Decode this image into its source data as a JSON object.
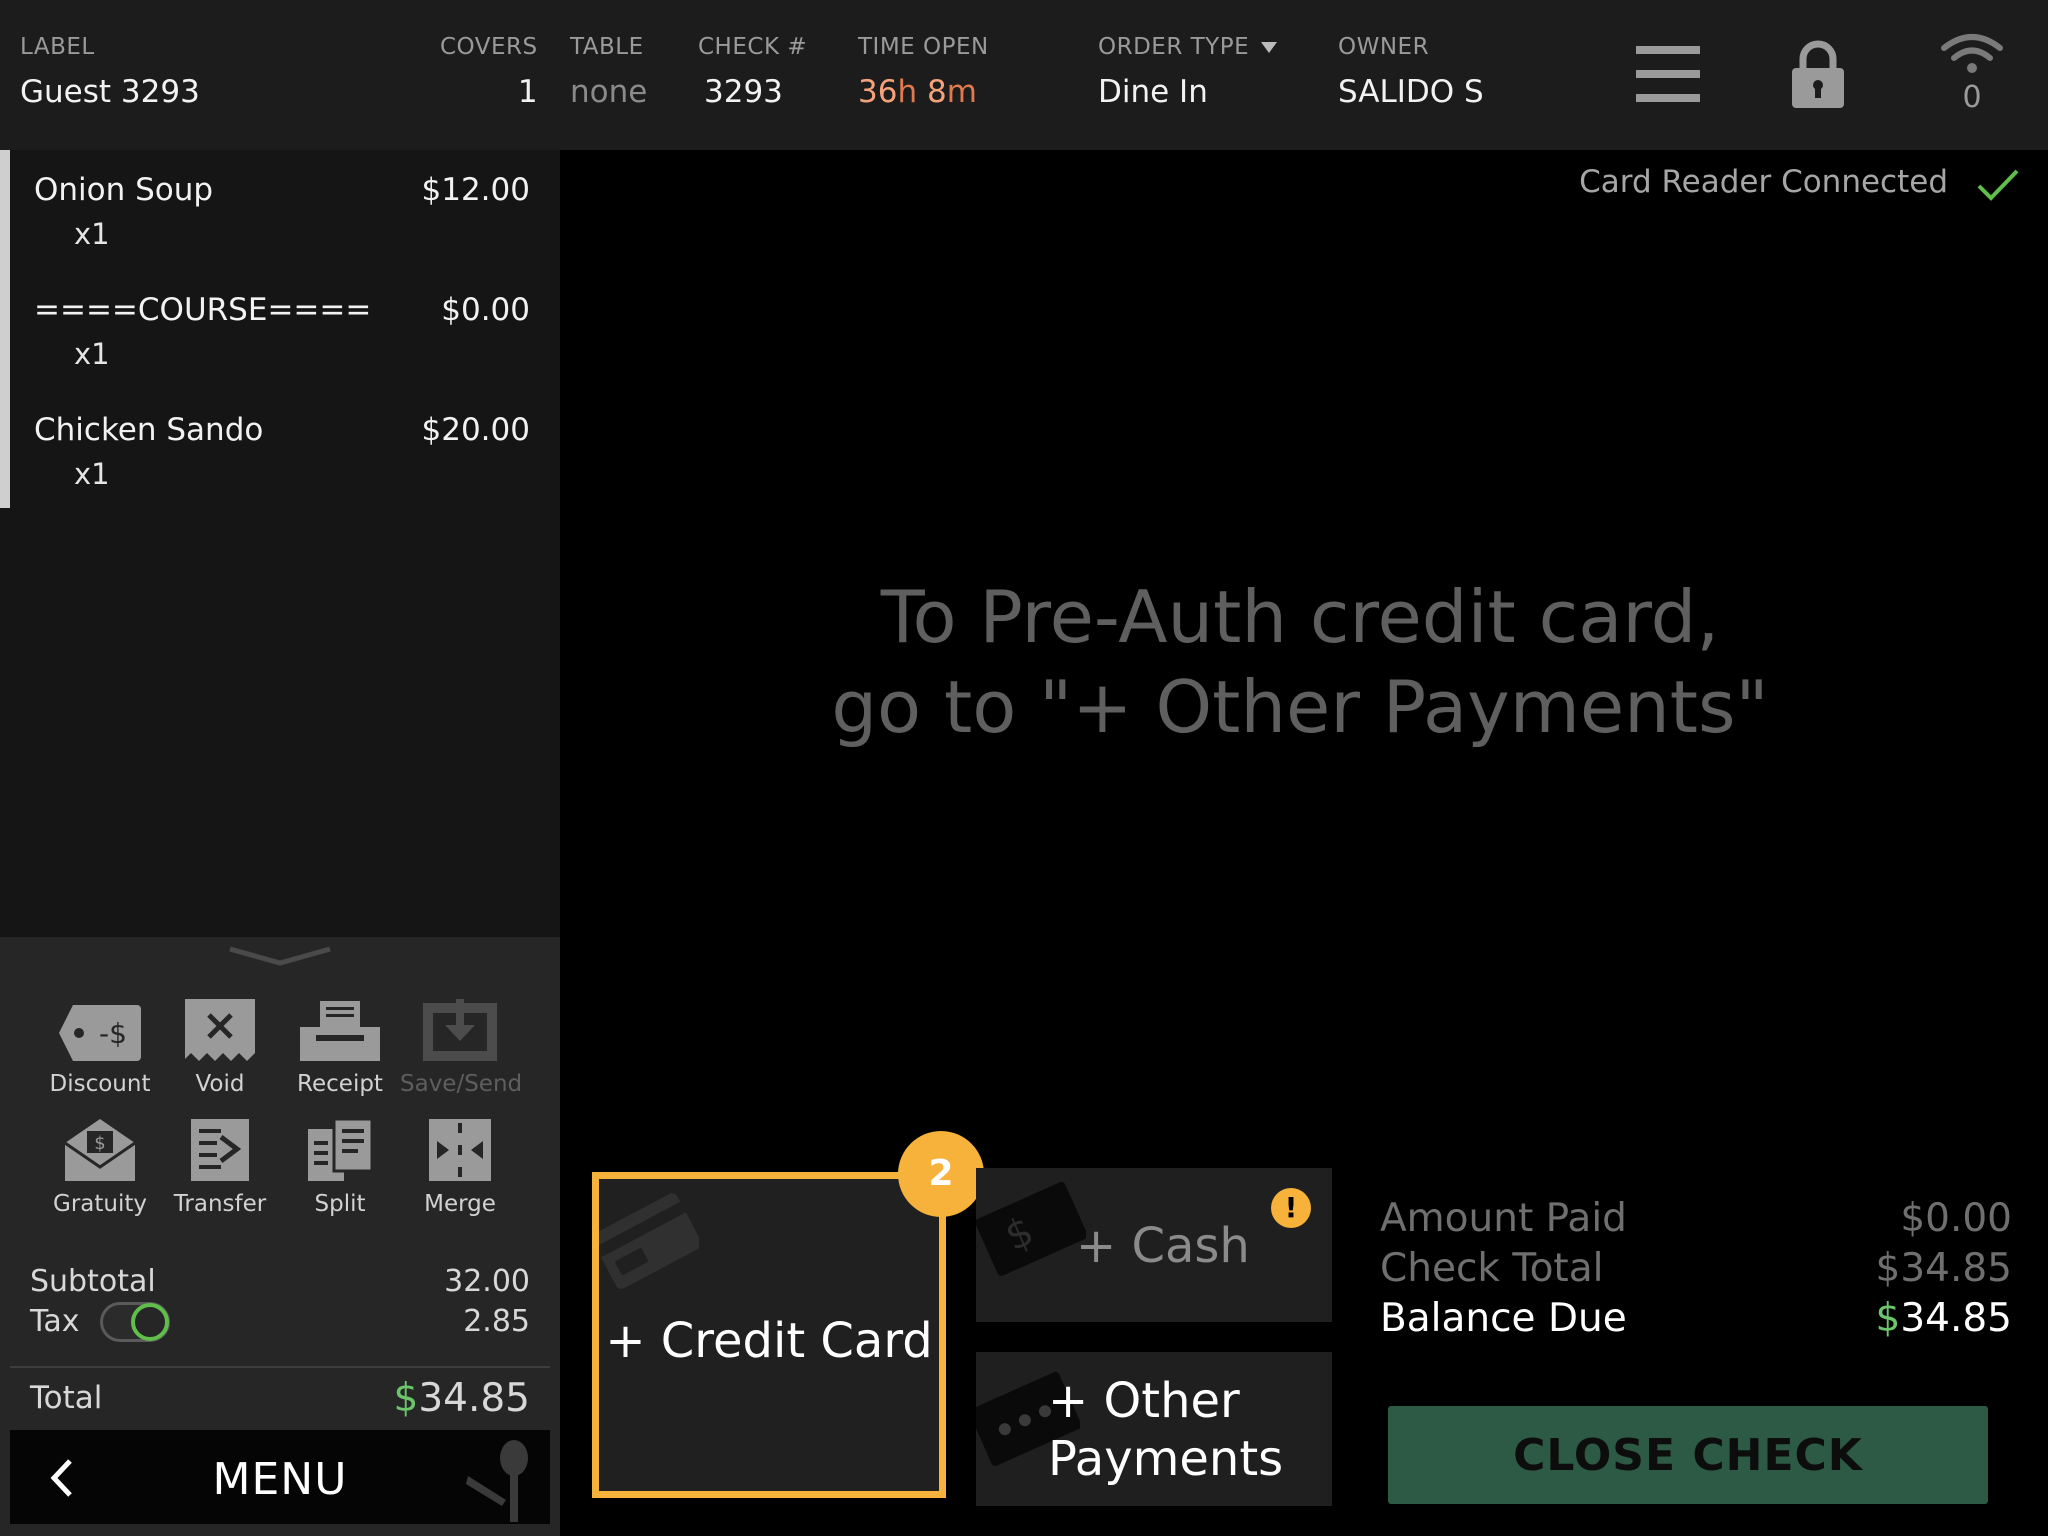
{
  "header": {
    "label": {
      "title": "LABEL",
      "value": "Guest 3293"
    },
    "covers": {
      "title": "COVERS",
      "value": "1"
    },
    "table": {
      "title": "TABLE",
      "value": "none"
    },
    "check": {
      "title": "CHECK #",
      "value": "3293"
    },
    "time_open": {
      "title": "TIME OPEN",
      "hours": "36",
      "h_unit": "h",
      "minutes": "8",
      "m_unit": "m"
    },
    "order_type": {
      "title": "ORDER TYPE",
      "value": "Dine In"
    },
    "owner": {
      "title": "OWNER",
      "value": "SALIDO S"
    },
    "wifi_count": "0",
    "icons": [
      "hamburger-menu-icon",
      "lock-icon",
      "wifi-icon"
    ]
  },
  "order": {
    "items": [
      {
        "name": "Onion Soup",
        "price": "$12.00",
        "qty": "x1"
      },
      {
        "name": "====COURSE====",
        "price": "$0.00",
        "qty": "x1"
      },
      {
        "name": "Chicken Sando",
        "price": "$20.00",
        "qty": "x1"
      }
    ]
  },
  "actions": {
    "discount": "Discount",
    "void": "Void",
    "receipt": "Receipt",
    "save_send": "Save/Send",
    "gratuity": "Gratuity",
    "transfer": "Transfer",
    "split": "Split",
    "merge": "Merge"
  },
  "totals": {
    "subtotal_label": "Subtotal",
    "subtotal": "32.00",
    "tax_label": "Tax",
    "tax": "2.85",
    "tax_enabled": true,
    "total_label": "Total",
    "total_currency": "$",
    "total": "34.85"
  },
  "menu_button": "MENU",
  "main": {
    "card_reader_status": "Card Reader Connected",
    "hint_line1": "To Pre-Auth credit card,",
    "hint_line2": "go to \"+ Other Payments\""
  },
  "payments": {
    "credit_card": "+ Credit Card",
    "credit_card_badge": "2",
    "cash": "+ Cash",
    "cash_warning": "!",
    "other_line1": "+ Other",
    "other_line2": "Payments"
  },
  "summary": {
    "amount_paid_label": "Amount Paid",
    "amount_paid": "$0.00",
    "check_total_label": "Check Total",
    "check_total": "$34.85",
    "balance_due_label": "Balance Due",
    "balance_currency": "$",
    "balance_due": "34.85"
  },
  "close_check": "CLOSE CHECK",
  "colors": {
    "accent": "#f6b23a",
    "positive": "#6cc56a",
    "time_orange": "#f4a27a",
    "close_button": "#2c5a44"
  }
}
